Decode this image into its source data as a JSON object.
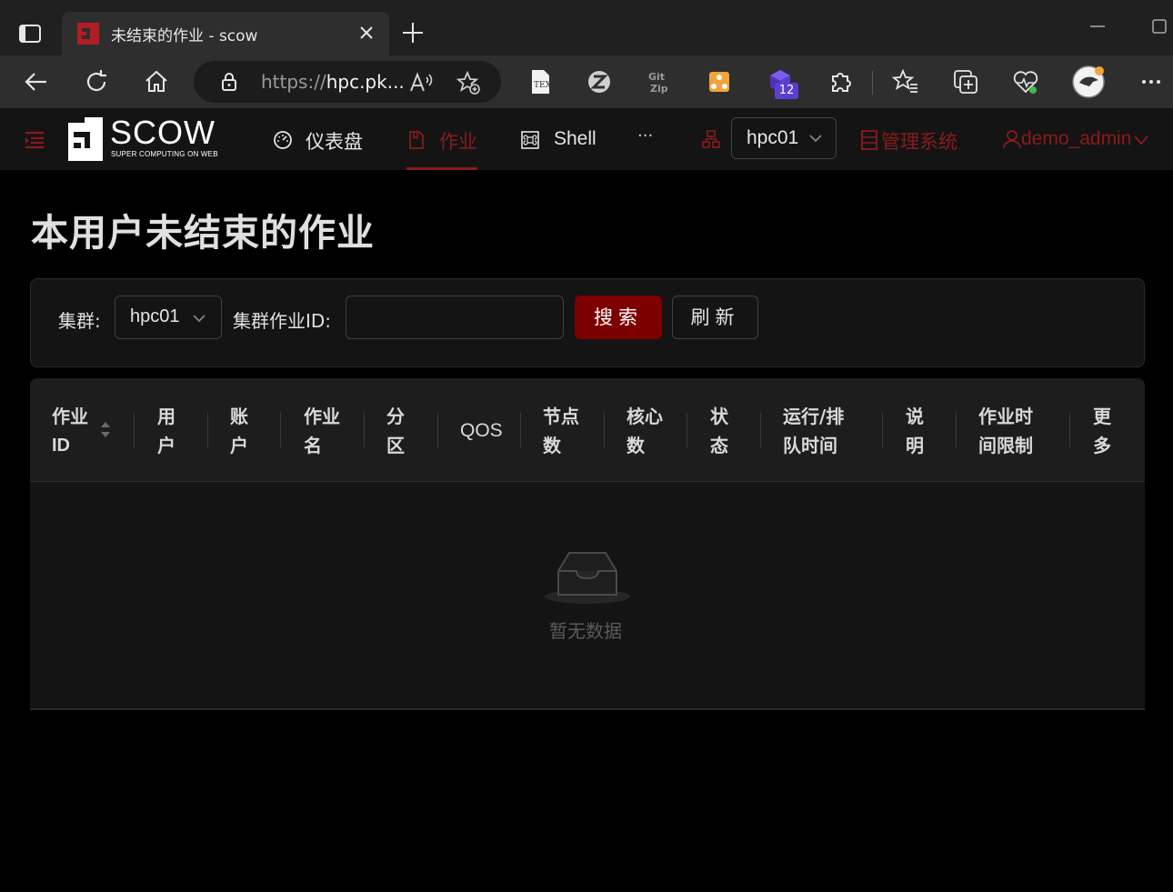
{
  "browser": {
    "tab_title": "未结束的作业 - scow",
    "url_protocol": "https://",
    "url_host": "hpc.pk...",
    "extension_badge": "12",
    "favicon_color": "#b01e24",
    "accent_color": "#5b3fd3"
  },
  "header": {
    "logo_title": "SCOW",
    "logo_subtitle": "SUPER COMPUTING ON WEB",
    "nav": [
      {
        "label": "仪表盘",
        "icon": "dashboard-icon"
      },
      {
        "label": "作业",
        "icon": "file-icon",
        "active": true
      },
      {
        "label": "Shell",
        "icon": "command-icon"
      }
    ],
    "more": "···",
    "cluster": "hpc01",
    "admin": "管理系统",
    "user": "demo_admin",
    "accent_color": "#8b1a1a"
  },
  "page": {
    "title": "本用户未结束的作业",
    "filter": {
      "cluster_label": "集群:",
      "cluster_value": "hpc01",
      "jobid_label": "集群作业ID:",
      "jobid_value": "",
      "search_button": "搜索",
      "refresh_button": "刷新"
    },
    "table": {
      "columns": [
        [
          "作业",
          "ID"
        ],
        [
          "用",
          "户"
        ],
        [
          "账",
          "户"
        ],
        [
          "作业",
          "名"
        ],
        [
          "分",
          "区"
        ],
        [
          "QOS"
        ],
        [
          "节点",
          "数"
        ],
        [
          "核心",
          "数"
        ],
        [
          "状",
          "态"
        ],
        [
          "运行/排",
          "队时间"
        ],
        [
          "说",
          "明"
        ],
        [
          "作业时",
          "间限制"
        ],
        [
          "更",
          "多"
        ]
      ],
      "rows": [],
      "empty_text": "暂无数据"
    },
    "primary_color": "#7d0000"
  }
}
